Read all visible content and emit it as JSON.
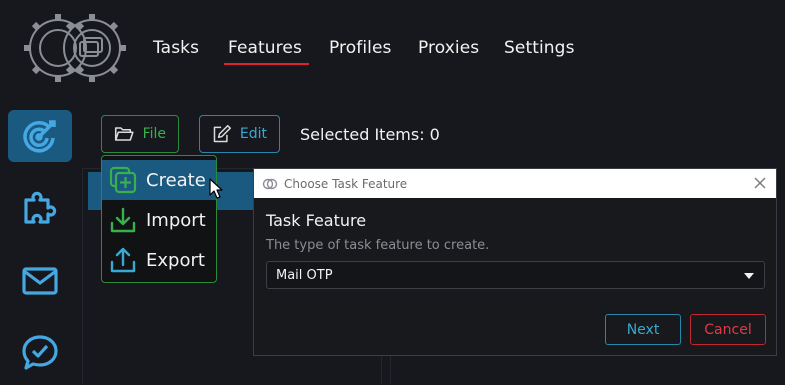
{
  "nav": {
    "tasks": "Tasks",
    "features": "Features",
    "profiles": "Profiles",
    "proxies": "Proxies",
    "settings": "Settings",
    "active": "Features"
  },
  "sidebar": {
    "items": [
      {
        "icon": "target-icon",
        "active": true
      },
      {
        "icon": "puzzle-icon",
        "active": false
      },
      {
        "icon": "mail-icon",
        "active": false
      },
      {
        "icon": "chat-check-icon",
        "active": false
      }
    ]
  },
  "toolbar": {
    "file_label": "File",
    "edit_label": "Edit",
    "selected_items": "Selected Items: 0"
  },
  "file_menu": {
    "items": [
      {
        "label": "Create",
        "icon": "add-file-icon"
      },
      {
        "label": "Import",
        "icon": "download-icon"
      },
      {
        "label": "Export",
        "icon": "upload-icon"
      }
    ]
  },
  "dialog": {
    "title": "Choose Task Feature",
    "heading": "Task Feature",
    "description": "The type of task feature to create.",
    "selected_value": "Mail OTP",
    "next_label": "Next",
    "cancel_label": "Cancel"
  },
  "colors": {
    "background": "#16181d",
    "accent_blue": "#1b5a80",
    "green": "#38b14c",
    "cyan": "#3aa9d1",
    "red": "#d9232e"
  }
}
